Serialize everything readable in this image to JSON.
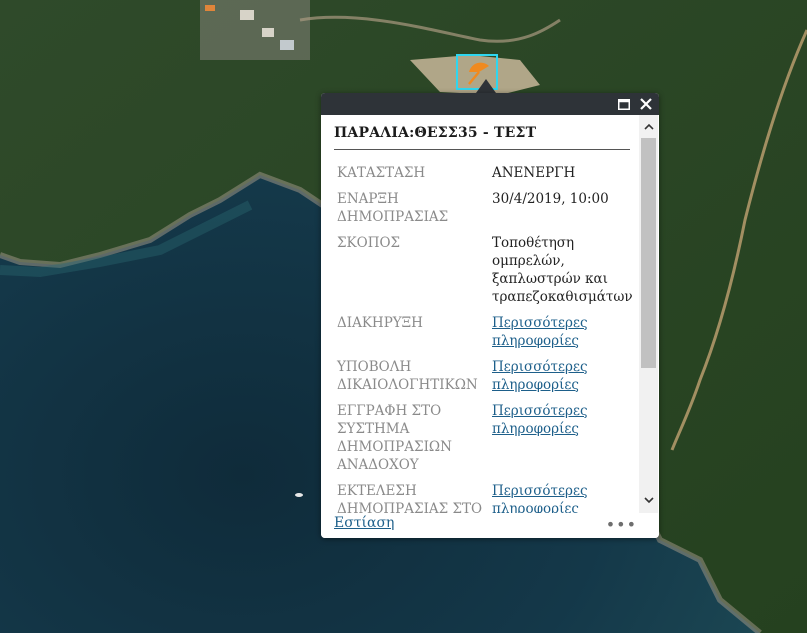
{
  "popup": {
    "title": "ΠΑΡΑΛΙΑ:ΘΕΣΣ35 - ΤΕΣΤ",
    "rows": [
      {
        "key": "ΚΑΤΑΣΤΑΣΗ",
        "value": "ΑΝΕΝΕΡΓΗ"
      },
      {
        "key": "ΕΝΑΡΞΗ ΔΗΜΟΠΡΑΣΙΑΣ",
        "value": "30/4/2019, 10:00"
      },
      {
        "key": "ΣΚΟΠΟΣ",
        "value": "Τοποθέτηση ομπρελών, ξαπλωστρών και τραπεζοκαθισμάτων"
      },
      {
        "key": "ΔΙΑΚΗΡΥΞΗ",
        "link": "Περισσότερες πληροφορίες"
      },
      {
        "key": "ΥΠΟΒΟΛΗ ΔΙΚΑΙΟΛΟΓΗΤΙΚΩΝ",
        "link": "Περισσότερες πληροφορίες"
      },
      {
        "key": "ΕΓΓΡΑΦΗ ΣΤΟ ΣΥΣΤΗΜΑ ΔΗΜΟΠΡΑΣΙΩΝ ΑΝΑΔΟΧΟΥ",
        "link": "Περισσότερες πληροφορίες"
      },
      {
        "key": "ΕΚΤΕΛΕΣΗ ΔΗΜΟΠΡΑΣΙΑΣ ΣΤΟ",
        "link": "Περισσότερες πληροφορίες"
      }
    ],
    "footer_link": "Εστίαση",
    "more_label": "•••"
  },
  "icons": {
    "maximize": "maximize-icon",
    "close": "close-icon",
    "scroll_up": "chevron-up-icon",
    "scroll_down": "chevron-down-icon",
    "marker": "beach-umbrella-icon"
  },
  "colors": {
    "header": "#2e3338",
    "link": "#1d5f8a",
    "highlight": "#2fd6ef",
    "marker": "#f08a1f"
  }
}
